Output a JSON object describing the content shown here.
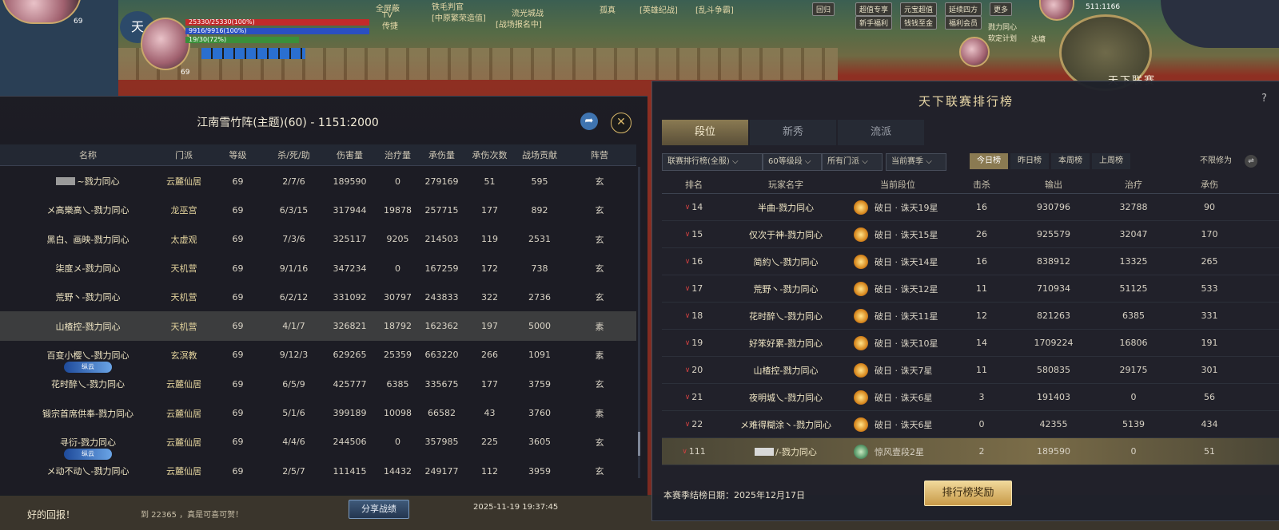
{
  "hud": {
    "player_level": "69",
    "side_level": "69",
    "hp_text": "25330/25330(100%)",
    "mp_text": "9916/9916(100%)",
    "sp_text": "19/30(72%)",
    "top_tags": [
      "全屏蔽",
      "TV",
      "传捷",
      "铁毛判官",
      "[中原繁荣造值]",
      "流光城战",
      "[战场报名中]",
      "孤真",
      "[英雄纪战]",
      "[乱斗争霸]"
    ],
    "buttons": [
      "回归",
      "超值专享",
      "元宝超值",
      "延续四方",
      "更多",
      "新手福利",
      "钱钱至金",
      "福利会员"
    ],
    "quest_lines": [
      "戮力同心",
      "软定计划"
    ],
    "quest_extra": "达塘",
    "coords": "511:1166",
    "bottom_banner": "天下联赛"
  },
  "battle_report": {
    "title": "江南雪竹阵(主题)(60) - 1151:2000",
    "columns": [
      "名称",
      "门派",
      "等级",
      "杀/死/助",
      "伤害量",
      "治疗量",
      "承伤量",
      "承伤次数",
      "战场贡献",
      "阵营"
    ],
    "badge_label": "纵云",
    "rows": [
      {
        "name": "~戮力同心",
        "sect": "云麓仙居",
        "level": "69",
        "kda": "2/7/6",
        "damage": "189590",
        "heal": "0",
        "taken": "279169",
        "hits": "51",
        "contrib": "595",
        "camp": "玄",
        "masked": true
      },
      {
        "name": "メ高樂高乀-戮力同心",
        "sect": "龙巫宫",
        "level": "69",
        "kda": "6/3/15",
        "damage": "317944",
        "heal": "19878",
        "taken": "257715",
        "hits": "177",
        "contrib": "892",
        "camp": "玄"
      },
      {
        "name": "黑白、画映-戮力同心",
        "sect": "太虚观",
        "level": "69",
        "kda": "7/3/6",
        "damage": "325117",
        "heal": "9205",
        "taken": "214503",
        "hits": "119",
        "contrib": "2531",
        "camp": "玄"
      },
      {
        "name": "柒度メ-戮力同心",
        "sect": "天机营",
        "level": "69",
        "kda": "9/1/16",
        "damage": "347234",
        "heal": "0",
        "taken": "167259",
        "hits": "172",
        "contrib": "738",
        "camp": "玄"
      },
      {
        "name": "荒野丶-戮力同心",
        "sect": "天机营",
        "level": "69",
        "kda": "6/2/12",
        "damage": "331092",
        "heal": "30797",
        "taken": "243833",
        "hits": "322",
        "contrib": "2736",
        "camp": "玄"
      },
      {
        "name": "山楂控-戮力同心",
        "sect": "天机营",
        "level": "69",
        "kda": "4/1/7",
        "damage": "326821",
        "heal": "18792",
        "taken": "162362",
        "hits": "197",
        "contrib": "5000",
        "camp": "素",
        "highlight": true
      },
      {
        "name": "百变小樱乀-戮力同心",
        "sect": "玄溟教",
        "level": "69",
        "kda": "9/12/3",
        "damage": "629265",
        "heal": "25359",
        "taken": "663220",
        "hits": "266",
        "contrib": "1091",
        "camp": "素",
        "badge": true
      },
      {
        "name": "花时醉乀-戮力同心",
        "sect": "云麓仙居",
        "level": "69",
        "kda": "6/5/9",
        "damage": "425777",
        "heal": "6385",
        "taken": "335675",
        "hits": "177",
        "contrib": "3759",
        "camp": "玄"
      },
      {
        "name": "锻宗首席供奉-戮力同心",
        "sect": "云麓仙居",
        "level": "69",
        "kda": "5/1/6",
        "damage": "399189",
        "heal": "10098",
        "taken": "66582",
        "hits": "43",
        "contrib": "3760",
        "camp": "素"
      },
      {
        "name": "寻衍-戮力同心",
        "sect": "云麓仙居",
        "level": "69",
        "kda": "4/4/6",
        "damage": "244506",
        "heal": "0",
        "taken": "357985",
        "hits": "225",
        "contrib": "3605",
        "camp": "玄",
        "badge": true
      },
      {
        "name": "メ动不动乀-戮力同心",
        "sect": "云麓仙居",
        "level": "69",
        "kda": "2/5/7",
        "damage": "111415",
        "heal": "14432",
        "taken": "249177",
        "hits": "112",
        "contrib": "3959",
        "camp": "玄"
      }
    ],
    "share_button": "分享战绩",
    "timestamp": "2025-11-19  19:37:45"
  },
  "chat": {
    "left": "好的回报！",
    "mid": "到 22365 ，真是可喜可贺！"
  },
  "ranking": {
    "title": "天下联赛排行榜",
    "help": "?",
    "tabs": [
      "段位",
      "新秀",
      "流派"
    ],
    "active_tab": 0,
    "filters": [
      "联赛排行榜(全服)",
      "60等级段",
      "所有门派",
      "当前赛季"
    ],
    "periods": [
      "今日榜",
      "昨日榜",
      "本周榜",
      "上周榜"
    ],
    "active_period": 0,
    "no_limit": "不限修为",
    "columns": [
      "排名",
      "玩家名字",
      "当前段位",
      "击杀",
      "输出",
      "治疗",
      "承伤"
    ],
    "rows": [
      {
        "rank": "14",
        "name": "半曲-戮力同心",
        "tier": "破日 · 诛天19星",
        "kills": "16",
        "output": "930796",
        "heal": "32788",
        "taken": "90"
      },
      {
        "rank": "15",
        "name": "仅次于神-戮力同心",
        "tier": "破日 · 诛天15星",
        "kills": "26",
        "output": "925579",
        "heal": "32047",
        "taken": "170"
      },
      {
        "rank": "16",
        "name": "简約乀-戮力同心",
        "tier": "破日 · 诛天14星",
        "kills": "16",
        "output": "838912",
        "heal": "13325",
        "taken": "265"
      },
      {
        "rank": "17",
        "name": "荒野丶-戮力同心",
        "tier": "破日 · 诛天12星",
        "kills": "11",
        "output": "710934",
        "heal": "51125",
        "taken": "533"
      },
      {
        "rank": "18",
        "name": "花时醉乀-戮力同心",
        "tier": "破日 · 诛天11星",
        "kills": "12",
        "output": "821263",
        "heal": "6385",
        "taken": "331"
      },
      {
        "rank": "19",
        "name": "好笨好累-戮力同心",
        "tier": "破日 · 诛天10星",
        "kills": "14",
        "output": "1709224",
        "heal": "16806",
        "taken": "191"
      },
      {
        "rank": "20",
        "name": "山楂控-戮力同心",
        "tier": "破日 · 诛天7星",
        "kills": "11",
        "output": "580835",
        "heal": "29175",
        "taken": "301"
      },
      {
        "rank": "21",
        "name": "夜明城乀-戮力同心",
        "tier": "破日 · 诛天6星",
        "kills": "3",
        "output": "191403",
        "heal": "0",
        "taken": "56"
      },
      {
        "rank": "22",
        "name": "メ难得糊涂丶-戮力同心",
        "tier": "破日 · 诛天6星",
        "kills": "0",
        "output": "42355",
        "heal": "5139",
        "taken": "434"
      },
      {
        "rank": "111",
        "name": "/-戮力同心",
        "tier": "惊风壹段2星",
        "kills": "2",
        "output": "189590",
        "heal": "0",
        "taken": "51",
        "me": true
      }
    ],
    "season_end": "本赛季结榜日期：2025年12月17日",
    "reward_button": "排行榜奖励"
  }
}
